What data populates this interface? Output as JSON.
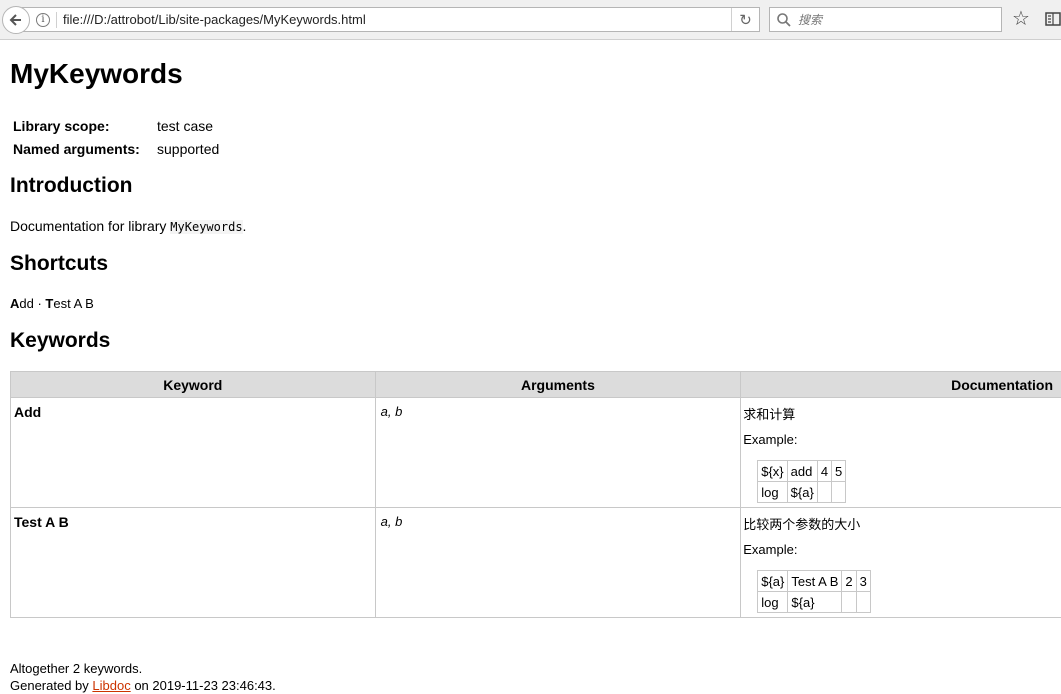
{
  "browser": {
    "url": "file:///D:/attrobot/Lib/site-packages/MyKeywords.html",
    "search_placeholder": "搜索"
  },
  "page": {
    "title": "MyKeywords",
    "meta": [
      {
        "key": "Library scope:",
        "value": "test case"
      },
      {
        "key": "Named arguments:",
        "value": "supported"
      }
    ],
    "intro_heading": "Introduction",
    "intro_prefix": "Documentation for library ",
    "intro_code": "MyKeywords",
    "intro_suffix": ".",
    "shortcuts_heading": "Shortcuts",
    "shortcuts": [
      {
        "initial": "A",
        "rest": "dd"
      },
      {
        "initial": "T",
        "rest": "est A B"
      }
    ],
    "shortcut_sep": " · ",
    "keywords_heading": "Keywords",
    "table_headers": [
      "Keyword",
      "Arguments",
      "Documentation"
    ],
    "keywords": [
      {
        "name": "Add",
        "args": "a, b",
        "doc": "求和计算",
        "example_label": "Example:",
        "example": [
          [
            "${x}",
            "add",
            "4",
            "5"
          ],
          [
            "log",
            "${a}",
            "",
            ""
          ]
        ]
      },
      {
        "name": "Test A B",
        "args": "a, b",
        "doc": "比较两个参数的大小",
        "example_label": "Example:",
        "example": [
          [
            "${a}",
            "Test A B",
            "2",
            "3"
          ],
          [
            "log",
            "${a}",
            "",
            ""
          ]
        ]
      }
    ],
    "footer_count": "Altogether 2 keywords.",
    "footer_gen_prefix": "Generated by ",
    "footer_gen_link": "Libdoc",
    "footer_gen_suffix": " on 2019-11-23 23:46:43."
  }
}
